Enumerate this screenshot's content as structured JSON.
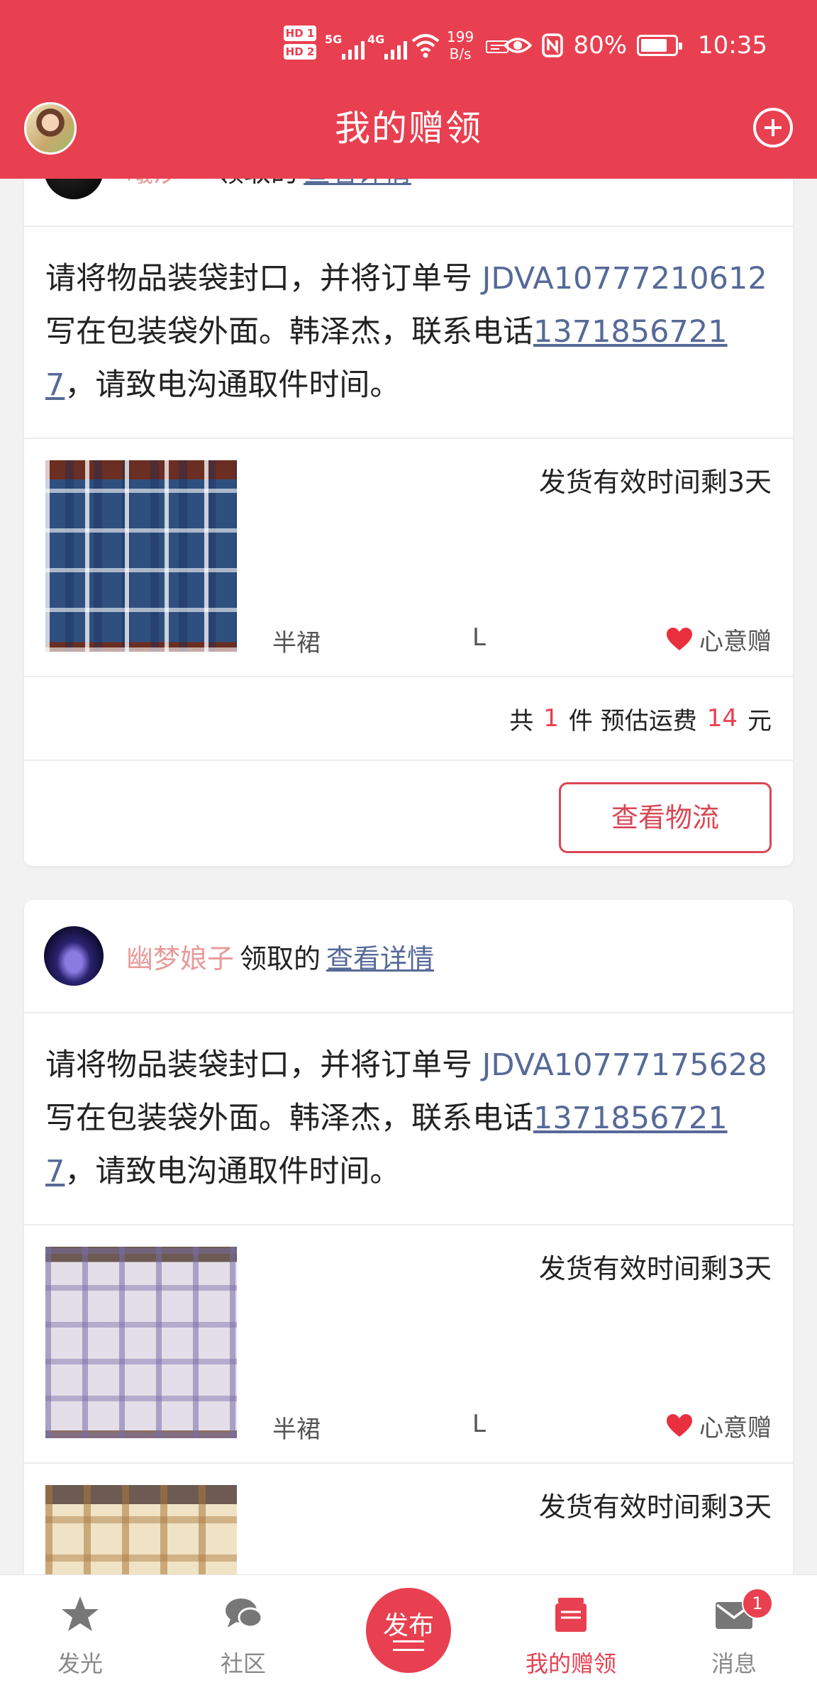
{
  "status_bar": {
    "hd1": "HD 1",
    "hd2": "HD 2",
    "net1": "5G",
    "net2": "4G",
    "speed_value": "199",
    "speed_unit": "B/s",
    "battery": "80%",
    "time": "10:35"
  },
  "header": {
    "title": "我的赠领"
  },
  "cards": [
    {
      "user": "曦汐 ~",
      "claimed_text": "领取的",
      "detail_link": "查看详情",
      "instructions": {
        "prefix": "请将物品装袋封口，并将订单号",
        "order_no": "JDVA10777210612",
        "mid": "写在包装袋外面。韩泽杰，联系电话",
        "phone": "13718567217",
        "suffix": "，请致电沟通取件时间。"
      },
      "items": [
        {
          "deadline": "发货有效时间剩3天",
          "category": "半裙",
          "size": "L",
          "gift_type": "心意赠"
        }
      ],
      "summary": {
        "prefix": "共",
        "count": "1",
        "mid": "件 预估运费",
        "fee": "14",
        "unit": "元"
      },
      "action": "查看物流"
    },
    {
      "user": "幽梦娘子",
      "claimed_text": "领取的",
      "detail_link": "查看详情",
      "instructions": {
        "prefix": "请将物品装袋封口，并将订单号",
        "order_no": "JDVA10777175628",
        "mid": "写在包装袋外面。韩泽杰，联系电话",
        "phone": "13718567217",
        "suffix": "，请致电沟通取件时间。"
      },
      "items": [
        {
          "deadline": "发货有效时间剩3天",
          "category": "半裙",
          "size": "L",
          "gift_type": "心意赠"
        },
        {
          "deadline": "发货有效时间剩3天"
        }
      ]
    }
  ],
  "nav": {
    "items": [
      {
        "label": "发光",
        "icon": "star-icon"
      },
      {
        "label": "社区",
        "icon": "chat-bubble-icon"
      },
      {
        "label": "发布",
        "icon": "publish-icon"
      },
      {
        "label": "我的赠领",
        "icon": "gift-box-icon",
        "active": true
      },
      {
        "label": "消息",
        "icon": "mail-icon",
        "badge": "1"
      }
    ]
  },
  "colors": {
    "brand": "#e84050",
    "link": "#566a98",
    "username": "#e89a9a",
    "inactive_nav": "#888888"
  }
}
